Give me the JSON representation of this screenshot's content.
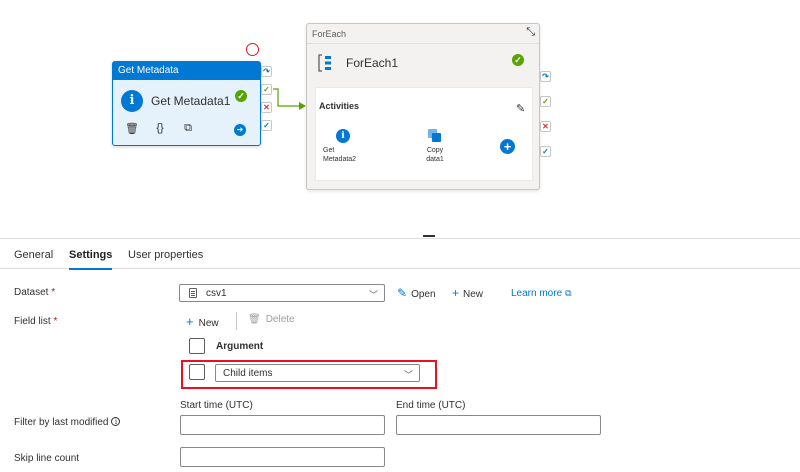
{
  "canvas": {
    "get_metadata_activity": {
      "header": "Get Metadata",
      "name": "Get Metadata1",
      "icons": [
        "info-icon",
        "success-check-icon",
        "delete-icon",
        "code-icon",
        "copy-icon",
        "go-arrow-icon"
      ]
    },
    "foreach_activity": {
      "header": "ForEach",
      "name": "ForEach1",
      "activities_label": "Activities",
      "inner_activities": [
        {
          "label_line1": "Get",
          "label_line2": "Metadata2"
        },
        {
          "label_line1": "Copy",
          "label_line2": "data1"
        }
      ]
    },
    "colors": {
      "accent": "#0078d4",
      "success": "#57a300",
      "failure": "#d13438",
      "highlight": "#e81123"
    }
  },
  "tabs": [
    {
      "label": "General",
      "active": false
    },
    {
      "label": "Settings",
      "active": true
    },
    {
      "label": "User properties",
      "active": false
    }
  ],
  "settings": {
    "dataset": {
      "label": "Dataset",
      "required_mark": "*",
      "value": "csv1",
      "open_label": "Open",
      "new_label": "New",
      "learn_more_label": "Learn more"
    },
    "field_list": {
      "label": "Field list",
      "required_mark": "*",
      "new_label": "New",
      "delete_label": "Delete",
      "header": "Argument",
      "rows": [
        {
          "value": "Child items"
        }
      ]
    },
    "filter_last_modified": {
      "label": "Filter by last modified",
      "start_label": "Start time (UTC)",
      "end_label": "End time (UTC)",
      "start_value": "",
      "end_value": ""
    },
    "skip_line_count": {
      "label": "Skip line count",
      "value": ""
    }
  }
}
